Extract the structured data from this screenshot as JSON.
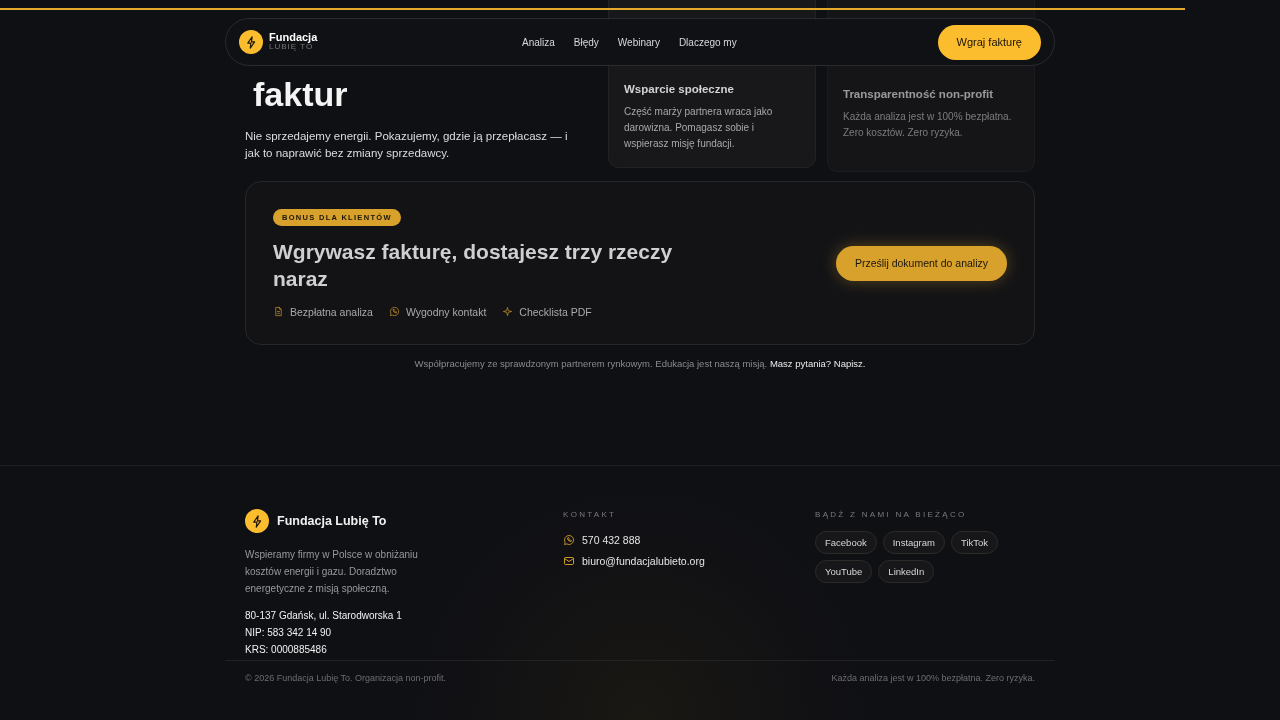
{
  "nav": {
    "brand": {
      "name": "Fundacja",
      "tagline": "LUBIĘ TO"
    },
    "links": [
      {
        "label": "Analiza"
      },
      {
        "label": "Błędy"
      },
      {
        "label": "Webinary"
      },
      {
        "label": "Dlaczego my"
      }
    ],
    "cta": "Wgraj fakturę"
  },
  "hero": {
    "heading": "faktur",
    "lead": "Nie sprzedajemy energii. Pokazujemy, gdzie ją przepłacasz — i jak to naprawić bez zmiany sprzedawcy.",
    "cards": [
      {
        "title": "Wsparcie społeczne",
        "text": "Część marży partnera wraca jako darowizna. Pomagasz sobie i wspierasz misję fundacji."
      },
      {
        "title": "Transparentność non-profit",
        "text": "Każda analiza jest w 100% bezpłatna. Zero kosztów. Zero ryzyka."
      }
    ]
  },
  "bonus": {
    "badge": "BONUS DLA KLIENTÓW",
    "title": "Wgrywasz fakturę, dostajesz trzy rzeczy naraz",
    "features": [
      {
        "kind": "document",
        "label": "Bezpłatna analiza"
      },
      {
        "kind": "phone",
        "label": "Wygodny kontakt"
      },
      {
        "kind": "sparkle",
        "label": "Checklista PDF"
      }
    ],
    "button": "Prześlij dokument do analizy"
  },
  "note": {
    "text": "Współpracujemy ze sprawdzonym partnerem rynkowym. Edukacja jest naszą misją.",
    "link": "Masz pytania? Napisz."
  },
  "footer": {
    "brand": "Fundacja Lubię To",
    "about": "Wspieramy firmy w Polsce w obniżaniu kosztów energii i gazu. Doradztwo energetyczne z misją społeczną.",
    "details": [
      "80-137 Gdańsk, ul. Starodworska 1",
      "NIP: 583 342 14 90",
      "KRS: 0000885486"
    ],
    "contact": {
      "heading": "KONTAKT",
      "items": [
        {
          "kind": "phone",
          "label": "570 432 888"
        },
        {
          "kind": "mail",
          "label": "biuro@fundacjalubieto.org"
        }
      ]
    },
    "social": {
      "heading": "BĄDŹ Z NAMI NA BIEŻĄCO",
      "links": [
        "Facebook",
        "Instagram",
        "TikTok",
        "YouTube",
        "LinkedIn"
      ]
    },
    "copyright": "© 2026 Fundacja Lubię To. Organizacja non-profit.",
    "tagline": "Każda analiza jest w 100% bezpłatna. Zero ryzyka."
  }
}
